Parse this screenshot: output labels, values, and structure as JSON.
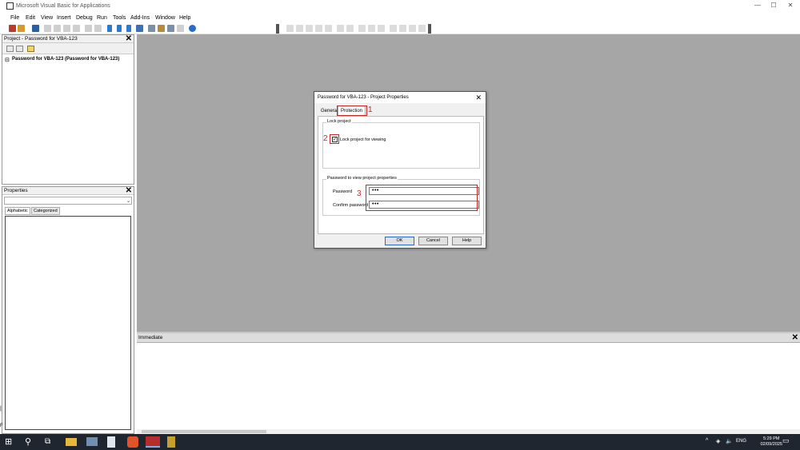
{
  "window": {
    "title": "Microsoft Visual Basic for Applications",
    "minimize": "—",
    "maximize": "☐",
    "close": "✕"
  },
  "menu": [
    "File",
    "Edit",
    "View",
    "Insert",
    "Debug",
    "Run",
    "Tools",
    "Add-Ins",
    "Window",
    "Help"
  ],
  "project_panel": {
    "title": "Project - Password for VBA-123",
    "close": "✕",
    "tree_node": "Password for VBA-123 (Password for VBA-123)"
  },
  "properties_panel": {
    "title": "Properties",
    "close": "✕",
    "tabs": [
      "Alphabetic",
      "Categorized"
    ]
  },
  "immediate": {
    "title": "Immediate",
    "close": "✕"
  },
  "dialog": {
    "title": "Password for VBA-123 - Project Properties",
    "close": "✕",
    "tabs": [
      "General",
      "Protection"
    ],
    "lock_group_label": "Lock project",
    "lock_checkbox_label": "Lock project for viewing",
    "lock_checked": true,
    "password_group_label": "Password to view project properties",
    "password_label": "Password",
    "password_value": "•••",
    "confirm_label": "Confirm password",
    "confirm_value": "•••",
    "buttons": [
      "OK",
      "Cancel",
      "Help"
    ]
  },
  "annotations": [
    "1",
    "2",
    "3"
  ],
  "annotation_color": "#c62828",
  "taskbar": {
    "language": "ENG",
    "time": "5:29 PM",
    "date": "02/09/2025"
  }
}
